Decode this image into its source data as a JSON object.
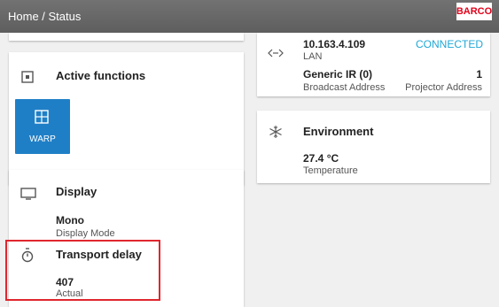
{
  "header": {
    "breadcrumb": "Home / Status",
    "logo": "BARCO"
  },
  "active_functions": {
    "icon": "active-functions-icon",
    "title": "Active functions",
    "tiles": [
      {
        "label": "WARP",
        "icon": "warp-icon"
      }
    ]
  },
  "display": {
    "icon": "display-monitor-icon",
    "title": "Display",
    "mode_value": "Mono",
    "mode_label": "Display Mode"
  },
  "transport_delay": {
    "icon": "stopwatch-icon",
    "title": "Transport delay",
    "value": "407",
    "label": "Actual"
  },
  "network": {
    "icon": "network-arrows-icon",
    "ip": "10.163.4.109",
    "status": "CONNECTED",
    "type": "LAN",
    "ir_name": "Generic IR (0)",
    "ir_broadcast_label": "Broadcast Address",
    "projector_address_value": "1",
    "projector_address_label": "Projector Address"
  },
  "environment": {
    "icon": "snowflake-icon",
    "title": "Environment",
    "temperature_value": "27.4 °C",
    "temperature_label": "Temperature"
  },
  "colors": {
    "accent": "#1f7fc6",
    "connected": "#1fa7d6",
    "highlight": "#e0262e",
    "topbar": "#666666"
  }
}
